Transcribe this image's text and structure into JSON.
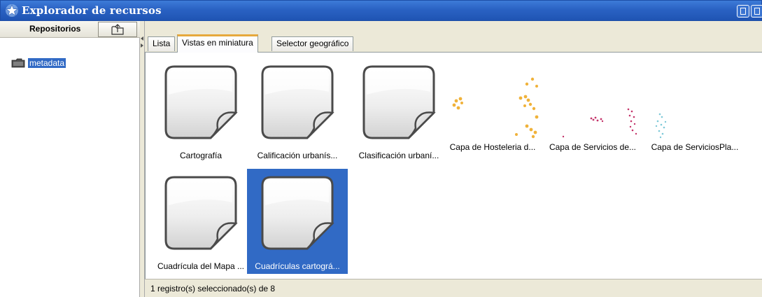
{
  "window": {
    "title": "Explorador de recursos",
    "star_icon": "star-icon",
    "buttons": [
      "minimize-icon",
      "restore-icon"
    ]
  },
  "left_panel": {
    "header_label": "Repositorios",
    "up_button_icon": "folder-up-icon",
    "tree": [
      {
        "label": "metadata",
        "icon": "folder-icon",
        "selected": true
      }
    ]
  },
  "tabs": [
    {
      "label": "Lista",
      "active": false
    },
    {
      "label": "Vistas en miniatura",
      "active": true
    },
    {
      "label": "Selector geográfico",
      "active": false
    }
  ],
  "thumbnails": [
    {
      "caption": "Cartografía",
      "type": "document",
      "selected": false
    },
    {
      "caption": "Calificación urbanís...",
      "type": "document",
      "selected": false
    },
    {
      "caption": "Clasificación urbaní...",
      "type": "document",
      "selected": false
    },
    {
      "caption": "Capa de Hosteleria d...",
      "type": "map",
      "color": "#f0b23a",
      "selected": false
    },
    {
      "caption": "Capa de Servicios de...",
      "type": "map",
      "color": "#c4346a",
      "selected": false
    },
    {
      "caption": "Capa de ServiciosPla...",
      "type": "map",
      "color": "#7ec9d8",
      "selected": false
    },
    {
      "caption": "Cuadrícula del Mapa ...",
      "type": "document",
      "selected": false
    },
    {
      "caption": "Cuadrículas cartográ...",
      "type": "document",
      "selected": true
    }
  ],
  "status": {
    "text": "1 registro(s) seleccionado(s) de 8"
  },
  "colors": {
    "titlebar": "#2a62c3",
    "selection": "#316ac5",
    "tab_accent": "#e6a93c",
    "panel_bg": "#ece9d8"
  }
}
